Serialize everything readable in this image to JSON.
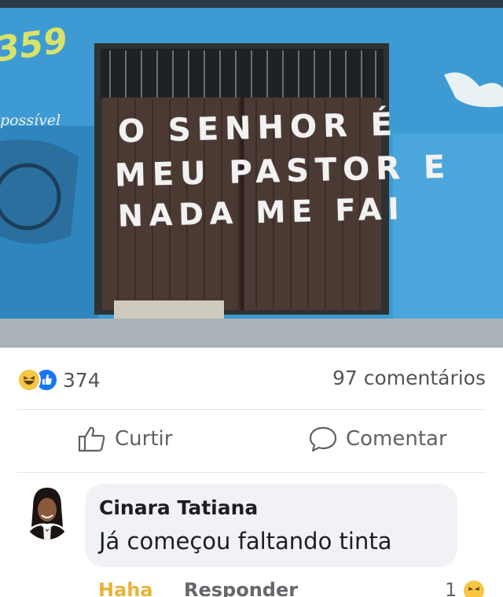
{
  "photo": {
    "gate_lines": [
      "O SENHOR É",
      "MEU PASTOR E",
      "NADA ME FAI"
    ],
    "wall_number": "359",
    "wall_word": "possível"
  },
  "post": {
    "reactions_count": "374",
    "comments_count": "97 comentários",
    "like_label": "Curtir",
    "comment_label": "Comentar"
  },
  "comment": {
    "author": "Cinara Tatiana",
    "text": "Já começou faltando tinta",
    "haha_label": "Haha",
    "reply_label": "Responder",
    "reaction_count": "1"
  },
  "colors": {
    "haha": "#f7c744",
    "like": "#1877f2",
    "bubble": "#f0f2f5"
  }
}
